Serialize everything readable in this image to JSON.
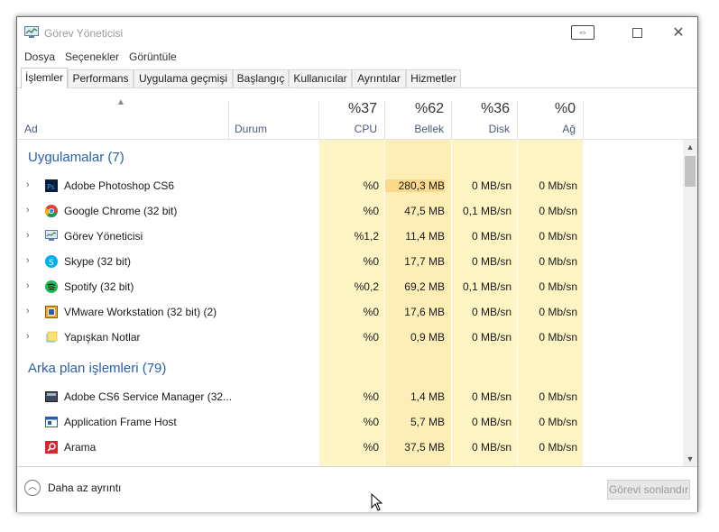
{
  "window": {
    "title": "Görev Yöneticisi"
  },
  "menu": [
    "Dosya",
    "Seçenekler",
    "Görüntüle"
  ],
  "tabs": [
    "İşlemler",
    "Performans",
    "Uygulama geçmişi",
    "Başlangıç",
    "Kullanıcılar",
    "Ayrıntılar",
    "Hizmetler"
  ],
  "columns": {
    "name": "Ad",
    "status": "Durum",
    "cpu": {
      "pct": "%37",
      "label": "CPU"
    },
    "memory": {
      "pct": "%62",
      "label": "Bellek"
    },
    "disk": {
      "pct": "%36",
      "label": "Disk"
    },
    "network": {
      "pct": "%0",
      "label": "Ağ"
    }
  },
  "groups": {
    "apps": {
      "title": "Uygulamalar (7)",
      "rows": [
        {
          "name": "Adobe Photoshop CS6",
          "icon": "photoshop-icon",
          "cpu": "%0",
          "mem": "280,3 MB",
          "disk": "0 MB/sn",
          "net": "0 Mb/sn"
        },
        {
          "name": "Google Chrome (32 bit)",
          "icon": "chrome-icon",
          "cpu": "%0",
          "mem": "47,5 MB",
          "disk": "0,1 MB/sn",
          "net": "0 Mb/sn"
        },
        {
          "name": "Görev Yöneticisi",
          "icon": "task-manager-icon",
          "cpu": "%1,2",
          "mem": "11,4 MB",
          "disk": "0 MB/sn",
          "net": "0 Mb/sn"
        },
        {
          "name": "Skype (32 bit)",
          "icon": "skype-icon",
          "cpu": "%0",
          "mem": "17,7 MB",
          "disk": "0 MB/sn",
          "net": "0 Mb/sn"
        },
        {
          "name": "Spotify (32 bit)",
          "icon": "spotify-icon",
          "cpu": "%0,2",
          "mem": "69,2 MB",
          "disk": "0,1 MB/sn",
          "net": "0 Mb/sn"
        },
        {
          "name": "VMware Workstation (32 bit) (2)",
          "icon": "vmware-icon",
          "cpu": "%0",
          "mem": "17,6 MB",
          "disk": "0 MB/sn",
          "net": "0 Mb/sn"
        },
        {
          "name": "Yapışkan Notlar",
          "icon": "sticky-notes-icon",
          "cpu": "%0",
          "mem": "0,9 MB",
          "disk": "0 MB/sn",
          "net": "0 Mb/sn"
        }
      ]
    },
    "background": {
      "title": "Arka plan işlemleri (79)",
      "rows": [
        {
          "name": "Adobe CS6 Service Manager (32...",
          "icon": "service-manager-icon",
          "cpu": "%0",
          "mem": "1,4 MB",
          "disk": "0 MB/sn",
          "net": "0 Mb/sn"
        },
        {
          "name": "Application Frame Host",
          "icon": "app-frame-icon",
          "cpu": "%0",
          "mem": "5,7 MB",
          "disk": "0 MB/sn",
          "net": "0 Mb/sn"
        },
        {
          "name": "Arama",
          "icon": "search-icon",
          "cpu": "%0",
          "mem": "37,5 MB",
          "disk": "0 MB/sn",
          "net": "0 Mb/sn"
        }
      ]
    }
  },
  "footer": {
    "less_details": "Daha az ayrıntı",
    "end_task": "Görevi sonlandır"
  },
  "colors": {
    "accent": "#2a5fae",
    "heat_light": "#fff4c4",
    "heat_medium": "#fde9a6",
    "header_text": "#4a5a78"
  }
}
